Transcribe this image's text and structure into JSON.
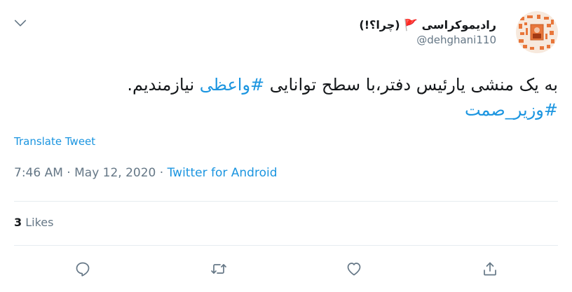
{
  "author": {
    "display_name": "رادیموکراسی 🚩 (چرا؟!)",
    "handle": "@dehghani110",
    "avatar": "avatar-image"
  },
  "tweet": {
    "text_before": "به یک منشی یارئیس دفتر،با سطح توانایی ",
    "hashtag_1": "#واعظی",
    "text_after": " نیازمندیم.",
    "hashtag_2": "#وزیر_صمت"
  },
  "translate_label": "Translate Tweet",
  "meta": {
    "time": "7:46 AM",
    "separator_1": " · ",
    "date": "May 12, 2020",
    "separator_2": " · ",
    "source": "Twitter for Android"
  },
  "stats": {
    "likes_count": "3",
    "likes_label": " Likes"
  },
  "icons": {
    "menu": "chevron-down-icon",
    "reply": "reply-icon",
    "retweet": "retweet-icon",
    "like": "heart-icon",
    "share": "share-icon"
  },
  "colors": {
    "link": "#1b95e0",
    "secondary_text": "#657786",
    "primary_text": "#14171a",
    "icon": "#657786",
    "divider": "#e6ecf0",
    "avatar_accent": "#e8763a"
  }
}
